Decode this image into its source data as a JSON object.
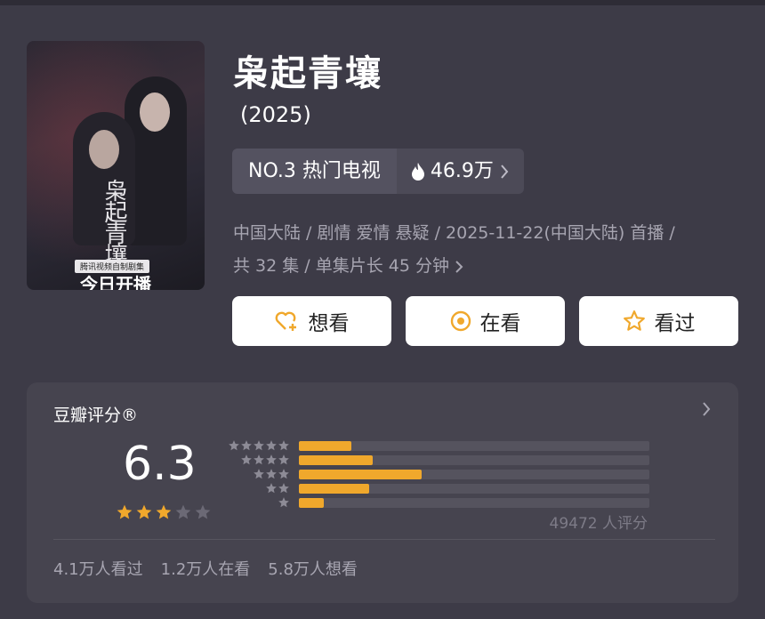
{
  "poster": {
    "calligraphy": "枭起青壤",
    "badge": "腾讯视频自制剧集",
    "airing": "今日开播"
  },
  "title": "枭起青壤",
  "year": "(2025)",
  "rank": {
    "label": "NO.3 热门电视",
    "heat": "46.9万",
    "heat_icon": "flame-icon"
  },
  "meta": {
    "line1": "中国大陆 / 剧情 爱情 悬疑 / 2025-11-22(中国大陆) 首播 /",
    "line2": "共 32 集 / 单集片长 45 分钟"
  },
  "buttons": {
    "want": "想看",
    "watching": "在看",
    "watched": "看过"
  },
  "rating": {
    "title": "豆瓣评分®",
    "score": "6.3",
    "stars_value": 3,
    "stars_max": 5,
    "histogram": [
      {
        "stars": 5,
        "percent": 15
      },
      {
        "stars": 4,
        "percent": 21
      },
      {
        "stars": 3,
        "percent": 35
      },
      {
        "stars": 2,
        "percent": 20
      },
      {
        "stars": 1,
        "percent": 7
      }
    ],
    "count": "49472 人评分",
    "stats": [
      "4.1万人看过",
      "1.2万人在看",
      "5.8万人想看"
    ]
  },
  "colors": {
    "background": "#3d3b47",
    "card": "#46444f",
    "accent": "#f0a82c",
    "muted": "#a7a5b1"
  }
}
